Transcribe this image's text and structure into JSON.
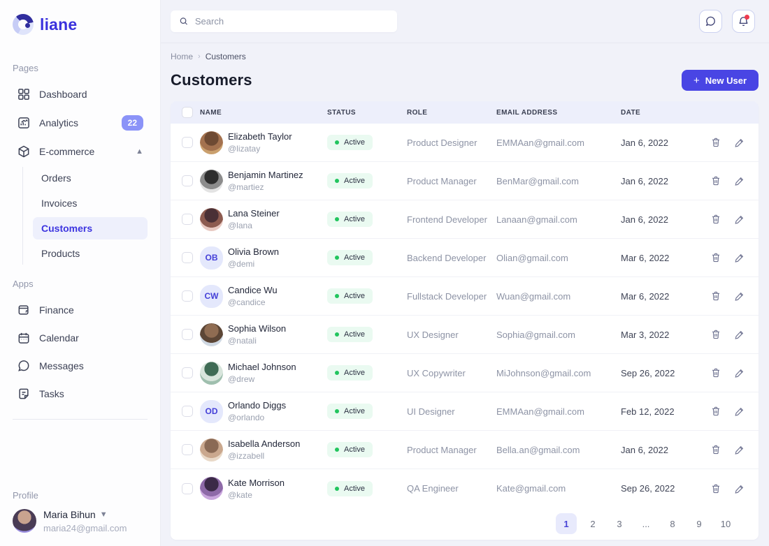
{
  "app": {
    "logo_text": "liane",
    "accent_color": "#4945e4"
  },
  "topbar": {
    "search_placeholder": "Search",
    "icons": [
      {
        "name": "support-chat-icon"
      },
      {
        "name": "bell-icon",
        "notification": true
      }
    ]
  },
  "sidebar": {
    "sections": [
      {
        "label": "Pages",
        "items": [
          {
            "label": "Dashboard",
            "icon": "grid-icon"
          },
          {
            "label": "Analytics",
            "icon": "analytics-icon",
            "badge": "22"
          },
          {
            "label": "E-commerce",
            "icon": "package-icon",
            "expanded": true,
            "children": [
              {
                "label": "Orders"
              },
              {
                "label": "Invoices"
              },
              {
                "label": "Customers",
                "active": true
              },
              {
                "label": "Products"
              }
            ]
          }
        ]
      },
      {
        "label": "Apps",
        "items": [
          {
            "label": "Finance",
            "icon": "wallet-icon"
          },
          {
            "label": "Calendar",
            "icon": "calendar-icon"
          },
          {
            "label": "Messages",
            "icon": "chat-icon"
          },
          {
            "label": "Tasks",
            "icon": "tasks-icon"
          }
        ]
      }
    ],
    "profile": {
      "label": "Profile",
      "name": "Maria Bihun",
      "email": "maria24@gmail.com"
    }
  },
  "page": {
    "breadcrumb": {
      "home": "Home",
      "current": "Customers"
    },
    "title": "Customers",
    "new_user": {
      "plus": "+",
      "label": "New User"
    }
  },
  "table": {
    "columns": {
      "name": "NAME",
      "status": "STATUS",
      "role": "ROLE",
      "email": "EMAIL ADDRESS",
      "date": "DATE"
    },
    "status_colors": {
      "pill_bg": "#eafaf1",
      "dot": "#22c55e"
    },
    "rows": [
      {
        "name": "Elizabeth Taylor",
        "handle": "@lizatay",
        "status": "Active",
        "role": "Product Designer",
        "email": "EMMAan@gmail.com",
        "date": "Jan 6, 2022",
        "avatar": {
          "kind": "photo",
          "colors": [
            "#caa06e",
            "#6e4a33",
            "#a4724f"
          ]
        }
      },
      {
        "name": "Benjamin Martinez",
        "handle": "@martiez",
        "status": "Active",
        "role": "Product Manager",
        "email": "BenMar@gmail.com",
        "date": "Jan 6, 2022",
        "avatar": {
          "kind": "photo",
          "colors": [
            "#e3e3e3",
            "#2e2e2e",
            "#8c8c8c"
          ]
        }
      },
      {
        "name": "Lana Steiner",
        "handle": "@lana",
        "status": "Active",
        "role": "Frontend Developer",
        "email": "Lanaan@gmail.com",
        "date": "Jan 6, 2022",
        "avatar": {
          "kind": "photo",
          "colors": [
            "#e8c9c2",
            "#4a3036",
            "#8d5b50"
          ]
        }
      },
      {
        "name": "Olivia Brown",
        "handle": "@demi",
        "status": "Active",
        "role": "Backend Developer",
        "email": "Olian@gmail.com",
        "date": "Mar 6, 2022",
        "avatar": {
          "kind": "initials",
          "initials": "OB"
        }
      },
      {
        "name": "Candice Wu",
        "handle": "@candice",
        "status": "Active",
        "role": "Fullstack Developer",
        "email": "Wuan@gmail.com",
        "date": "Mar 6, 2022",
        "avatar": {
          "kind": "initials",
          "initials": "CW"
        }
      },
      {
        "name": "Sophia Wilson",
        "handle": "@natali",
        "status": "Active",
        "role": "UX Designer",
        "email": "Sophia@gmail.com",
        "date": "Mar 3, 2022",
        "avatar": {
          "kind": "photo",
          "colors": [
            "#cfd8e2",
            "#8f6c52",
            "#5c4636"
          ]
        }
      },
      {
        "name": "Michael Johnson",
        "handle": "@drew",
        "status": "Active",
        "role": "UX Copywriter",
        "email": "MiJohnson@gmail.com",
        "date": "Sep 26, 2022",
        "avatar": {
          "kind": "photo",
          "colors": [
            "#9fbfae",
            "#3f6b55",
            "#d8e5dc"
          ]
        }
      },
      {
        "name": "Orlando Diggs",
        "handle": "@orlando",
        "status": "Active",
        "role": "UI Designer",
        "email": "EMMAan@gmail.com",
        "date": "Feb 12, 2022",
        "avatar": {
          "kind": "initials",
          "initials": "OD"
        }
      },
      {
        "name": "Isabella Anderson",
        "handle": "@izzabell",
        "status": "Active",
        "role": "Product Manager",
        "email": "Bella.an@gmail.com",
        "date": "Jan 6, 2022",
        "avatar": {
          "kind": "photo",
          "colors": [
            "#e9d9c8",
            "#8a6a55",
            "#caa88e"
          ]
        }
      },
      {
        "name": "Kate Morrison",
        "handle": "@kate",
        "status": "Active",
        "role": "QA Engineer",
        "email": "Kate@gmail.com",
        "date": "Sep 26, 2022",
        "avatar": {
          "kind": "photo",
          "colors": [
            "#c9a6dd",
            "#3b2a47",
            "#8e6aa8"
          ]
        }
      }
    ]
  },
  "pagination": {
    "pages": [
      "1",
      "2",
      "3",
      "...",
      "8",
      "9",
      "10"
    ],
    "active_index": 0
  }
}
